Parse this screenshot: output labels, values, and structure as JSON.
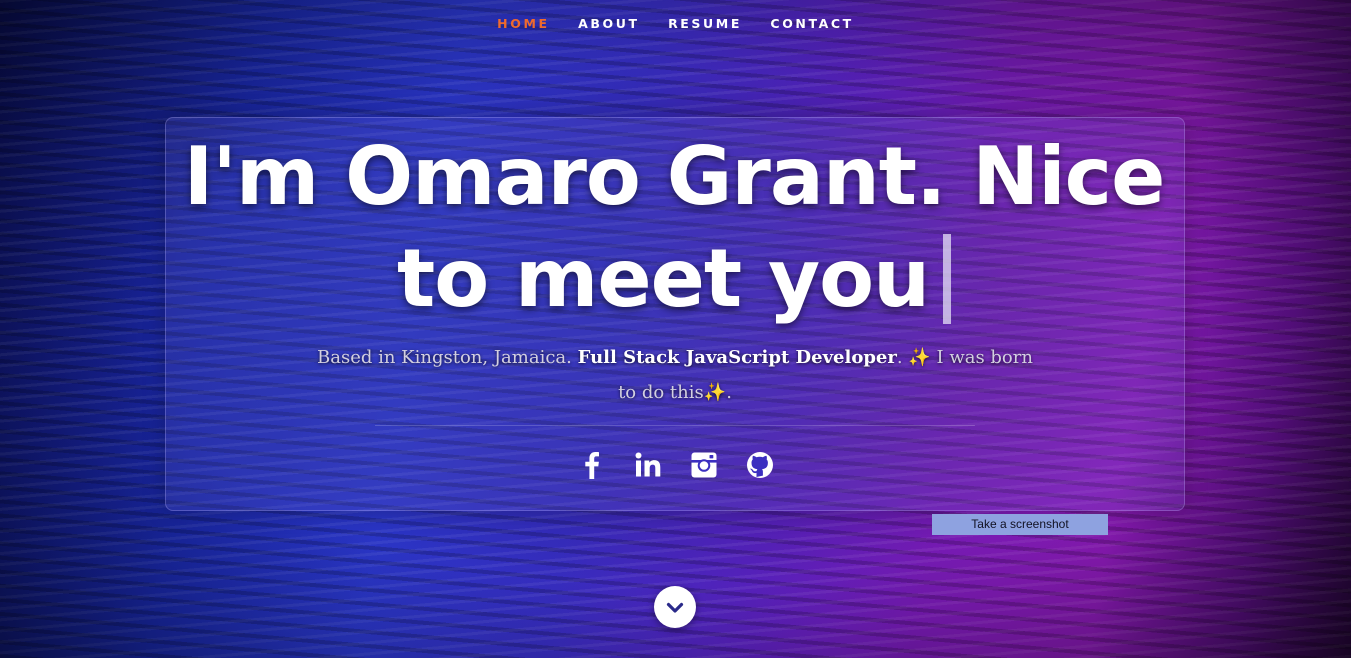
{
  "nav": {
    "items": [
      {
        "label": "HOME",
        "active": true
      },
      {
        "label": "ABOUT",
        "active": false
      },
      {
        "label": "RESUME",
        "active": false
      },
      {
        "label": "CONTACT",
        "active": false
      }
    ],
    "active_color": "#ef6a2c"
  },
  "hero": {
    "headline_line1": "I'm Omaro Grant. Nice",
    "headline_line2": "to meet you",
    "subtitle": {
      "part1": "Based in Kingston, Jamaica. ",
      "role": "Full Stack JavaScript Developer",
      "part2": ". ",
      "sparkle1": "✨",
      "part3": "I was born to do this",
      "sparkle2": "✨",
      "part4": "."
    }
  },
  "socials": [
    {
      "icon": "facebook-icon"
    },
    {
      "icon": "linkedin-icon"
    },
    {
      "icon": "instagram-icon"
    },
    {
      "icon": "github-icon"
    }
  ],
  "tooltip": {
    "label": "Take a screenshot"
  },
  "scroll_button": {
    "icon": "chevron-down-icon"
  }
}
